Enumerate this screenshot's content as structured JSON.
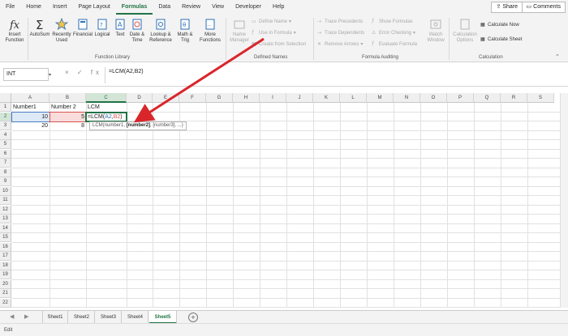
{
  "tabs": [
    "File",
    "Home",
    "Insert",
    "Page Layout",
    "Formulas",
    "Data",
    "Review",
    "View",
    "Developer",
    "Help"
  ],
  "active_tab": "Formulas",
  "share_label": "Share",
  "comments_label": "Comments",
  "ribbon": {
    "insert_function": "Insert\nFunction",
    "autosum": "AutoSum",
    "recently_used": "Recently\nUsed",
    "financial": "Financial",
    "logical": "Logical",
    "text": "Text",
    "date_time": "Date &\nTime",
    "lookup_reference": "Lookup &\nReference",
    "math_trig": "Math &\nTrig",
    "more_functions": "More\nFunctions",
    "function_library_label": "Function Library",
    "name_manager": "Name\nManager",
    "define_name": "Define Name",
    "use_in_formula": "Use in Formula",
    "create_from_selection": "Create from Selection",
    "defined_names_label": "Defined Names",
    "trace_precedents": "Trace Precedents",
    "trace_dependents": "Trace Dependents",
    "remove_arrows": "Remove Arrows",
    "show_formulas": "Show Formulas",
    "error_checking": "Error Checking",
    "evaluate_formula": "Evaluate Formula",
    "watch_window": "Watch\nWindow",
    "formula_auditing_label": "Formula Auditing",
    "calculation_options": "Calculation\nOptions",
    "calculate_now": "Calculate Now",
    "calculate_sheet": "Calculate Sheet",
    "calculation_label": "Calculation"
  },
  "formula_bar": {
    "name_box": "INT",
    "fx_symbols": "× ✓ fx",
    "formula": "=LCM(A2,B2)"
  },
  "columns": [
    "A",
    "B",
    "C",
    "D",
    "E",
    "F",
    "G",
    "H",
    "I",
    "J",
    "K",
    "L",
    "M",
    "N",
    "O",
    "P",
    "Q",
    "R",
    "S"
  ],
  "rows": [
    "1",
    "2",
    "3",
    "4",
    "5",
    "6",
    "7",
    "8",
    "9",
    "10",
    "11",
    "12",
    "13",
    "14",
    "15",
    "16",
    "17",
    "18",
    "19",
    "20",
    "21",
    "22"
  ],
  "cells": {
    "A1": "Number1",
    "B1": "Number 2",
    "C1": "LCM",
    "A2": "10",
    "B2": "5",
    "C2_prefix": "=LCM(",
    "C2_ref1": "A2",
    "C2_comma": ",",
    "C2_ref2": "B2",
    "C2_suffix": ")",
    "A3": "20",
    "B3": "8"
  },
  "tooltip": {
    "prefix": "LCM(number1, ",
    "bold": "[number2]",
    "suffix": ", [number3], ...)"
  },
  "sheets": [
    "Sheet1",
    "Sheet2",
    "Sheet3",
    "Sheet4",
    "Sheet5"
  ],
  "active_sheet": "Sheet5",
  "add_sheet": "+",
  "status": "Edit",
  "colors": {
    "accent": "#217346",
    "arrow": "#d9262b"
  }
}
